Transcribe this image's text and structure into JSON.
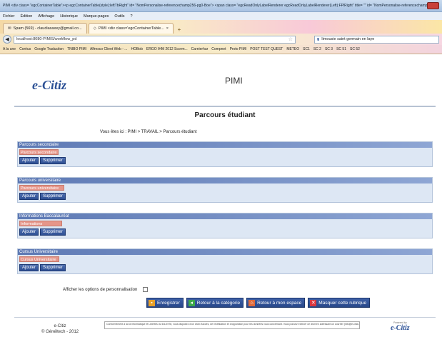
{
  "browser": {
    "window_title": "PIMI <div class= \"egcContainerTable\"><p egcContainerTable(style):leftTbRight\" id= \"NomPersonalise-referencechamp256-pg0-Boe\"> <span class= \"egcReadOnlyLabelRenderer egcReadOnlyLabelRenderer(Left):FPlRight\" title= \"\" id= \"NomPersonalise-referencechamp256-pg0 <Fe",
    "menu": [
      "Fichier",
      "Édition",
      "Affichage",
      "Historique",
      "Marque-pages",
      "Outils",
      "?"
    ],
    "tabs": [
      {
        "label": "Spam (569) - claudiasaxey@gmail.co...",
        "active": false
      },
      {
        "label": "PIMI <div class='egcContainerTable...",
        "active": true
      }
    ],
    "url": "localhost:8080-PIMIS/workflow_pd",
    "search_value": "limousie saint germain en laye",
    "bookmarks": [
      "A la une",
      "Coréus",
      "Google Traduction",
      "TNIBO PIMI",
      "Alfresco Client Web - ...",
      "HOBob",
      "ERGO IHM 2012 Scorm...",
      "Carnierhar",
      "Compnet",
      "Proto PIMI",
      "POST TEST QUEST",
      "METEO",
      "SC1",
      "SC 2",
      "SC 3",
      "SC 51",
      "SC 52"
    ]
  },
  "header": {
    "logo": "e-Citiz",
    "app_name": "PIMI"
  },
  "page": {
    "title": "Parcours étudiant",
    "breadcrumb": "Vous êtes ici :  PIMI > TRAVAIL > Parcours étudiant"
  },
  "sections": [
    {
      "header": "Parcours secondaire",
      "field": "Parcours secondaire",
      "add": "Ajouter",
      "delete": "Supprimer"
    },
    {
      "header": "Parcours universitaire",
      "field": "Parcours universitaire",
      "add": "Ajouter",
      "delete": "Supprimer"
    },
    {
      "header": "Informations Baccalauréat",
      "field": "Informations Baccalauréat",
      "add": "Ajouter",
      "delete": "Supprimer"
    },
    {
      "header": "Cursus Universitaire",
      "field": "Cursus Universitaire",
      "add": "Ajouter",
      "delete": "Supprimer"
    }
  ],
  "options": {
    "label": "Afficher les options de personnalisation",
    "checked": false
  },
  "actions": {
    "save": "Enregistrer",
    "back_category": "Retour à la catégorie",
    "back_space": "Retour à mon espace",
    "hide": "Masquer cette rubrique"
  },
  "footer": {
    "brand_line1": "e-Citiz",
    "brand_line2": "© Généltech - 2012",
    "legal": "Conformément à la loi informatique et Libertés du 6/1/1978, vous disposez d'un droit d'accès, de rectification et d'opposition pour les données vous concernant. Vous pouvez exercer ce droit en adressant un courrier (info@e-citiz.com)",
    "powered_by": "Powered by",
    "powered_logo": "e-Citiz"
  }
}
